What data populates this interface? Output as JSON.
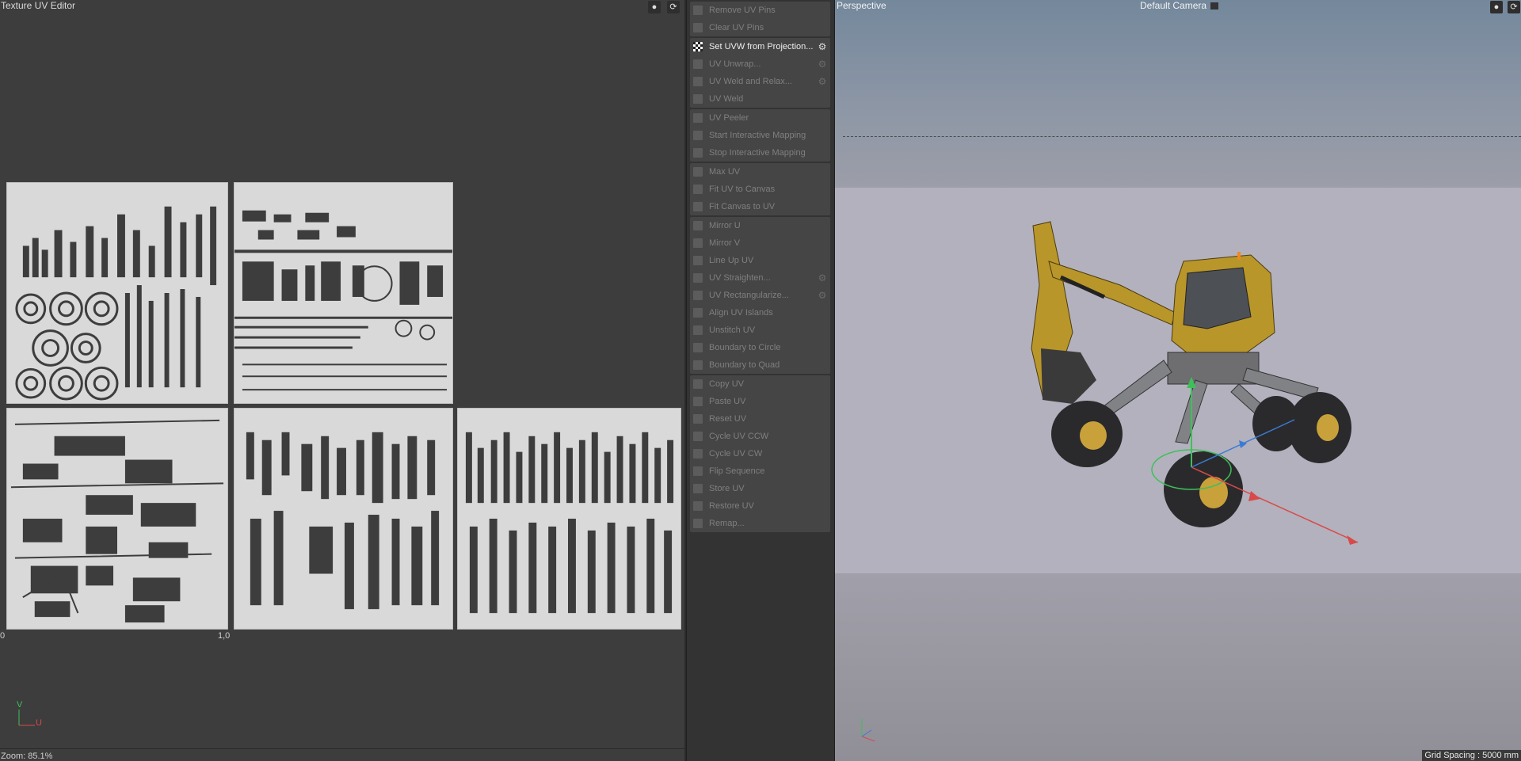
{
  "uv_editor": {
    "title": "Texture UV Editor",
    "icons": [
      "microphone-icon",
      "sync-icon"
    ],
    "coord_start": "0",
    "coord_end": "1,0",
    "axis_v": "V",
    "axis_u": "U",
    "zoom": "Zoom: 85.1%"
  },
  "commands": {
    "groups": [
      [
        {
          "label": "Remove UV Pins",
          "active": false,
          "gear": false,
          "icon": "pin-remove-icon"
        },
        {
          "label": "Clear UV Pins",
          "active": false,
          "gear": false,
          "icon": "pin-clear-icon"
        }
      ],
      [
        {
          "label": "Set UVW from Projection...",
          "active": true,
          "gear": true,
          "icon": "checker-icon"
        },
        {
          "label": "UV Unwrap...",
          "active": false,
          "gear": true,
          "icon": "unwrap-icon"
        },
        {
          "label": "UV Weld and Relax...",
          "active": false,
          "gear": true,
          "icon": "weld-relax-icon"
        },
        {
          "label": "UV Weld",
          "active": false,
          "gear": false,
          "icon": "weld-icon"
        }
      ],
      [
        {
          "label": "UV Peeler",
          "active": false,
          "gear": false,
          "icon": "peeler-icon"
        },
        {
          "label": "Start Interactive Mapping",
          "active": false,
          "gear": false,
          "icon": "mapping-start-icon"
        },
        {
          "label": "Stop Interactive Mapping",
          "active": false,
          "gear": false,
          "icon": "mapping-stop-icon"
        }
      ],
      [
        {
          "label": "Max UV",
          "active": false,
          "gear": false,
          "icon": "max-uv-icon"
        },
        {
          "label": "Fit UV to Canvas",
          "active": false,
          "gear": false,
          "icon": "fit-uv-icon"
        },
        {
          "label": "Fit Canvas to UV",
          "active": false,
          "gear": false,
          "icon": "fit-canvas-icon"
        }
      ],
      [
        {
          "label": "Mirror U",
          "active": false,
          "gear": false,
          "icon": "mirror-u-icon"
        },
        {
          "label": "Mirror V",
          "active": false,
          "gear": false,
          "icon": "mirror-v-icon"
        },
        {
          "label": "Line Up UV",
          "active": false,
          "gear": false,
          "icon": "line-up-icon"
        },
        {
          "label": "UV Straighten...",
          "active": false,
          "gear": true,
          "icon": "straighten-icon"
        },
        {
          "label": "UV Rectangularize...",
          "active": false,
          "gear": true,
          "icon": "rectangularize-icon"
        },
        {
          "label": "Align UV Islands",
          "active": false,
          "gear": false,
          "icon": "align-islands-icon"
        },
        {
          "label": "Unstitch UV",
          "active": false,
          "gear": false,
          "icon": "unstitch-icon"
        },
        {
          "label": "Boundary to Circle",
          "active": false,
          "gear": false,
          "icon": "boundary-circle-icon"
        },
        {
          "label": "Boundary to Quad",
          "active": false,
          "gear": false,
          "icon": "boundary-quad-icon"
        }
      ],
      [
        {
          "label": "Copy UV",
          "active": false,
          "gear": false,
          "icon": "copy-icon"
        },
        {
          "label": "Paste UV",
          "active": false,
          "gear": false,
          "icon": "paste-icon"
        },
        {
          "label": "Reset UV",
          "active": false,
          "gear": false,
          "icon": "reset-icon"
        },
        {
          "label": "Cycle UV CCW",
          "active": false,
          "gear": false,
          "icon": "cycle-ccw-icon"
        },
        {
          "label": "Cycle UV CW",
          "active": false,
          "gear": false,
          "icon": "cycle-cw-icon"
        },
        {
          "label": "Flip Sequence",
          "active": false,
          "gear": false,
          "icon": "flip-icon"
        },
        {
          "label": "Store UV",
          "active": false,
          "gear": false,
          "icon": "store-icon"
        },
        {
          "label": "Restore UV",
          "active": false,
          "gear": false,
          "icon": "restore-icon"
        },
        {
          "label": "Remap...",
          "active": false,
          "gear": false,
          "icon": "remap-icon"
        }
      ]
    ]
  },
  "viewport": {
    "title": "Perspective",
    "camera": "Default Camera",
    "icons": [
      "camera-icon",
      "microphone-icon",
      "sync-icon"
    ],
    "grid_spacing": "Grid Spacing : 5000 mm",
    "sky_color": "#74889c",
    "floor_color": "#b3b1bd",
    "model_color": "#b8962a"
  }
}
